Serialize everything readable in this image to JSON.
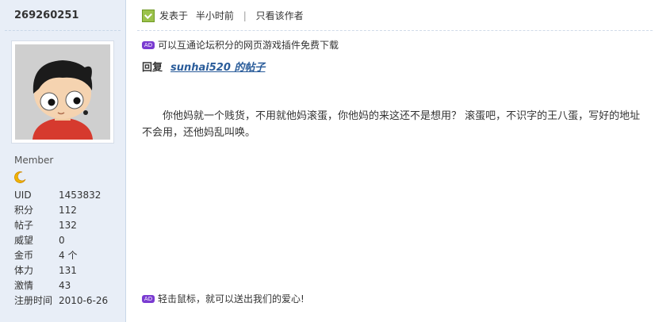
{
  "user": {
    "name": "269260251",
    "rank": "Member",
    "stats": [
      {
        "label": "UID",
        "value": "1453832"
      },
      {
        "label": "积分",
        "value": "112"
      },
      {
        "label": "帖子",
        "value": "132"
      },
      {
        "label": "威望",
        "value": "0"
      },
      {
        "label": "金币",
        "value": "4 个"
      },
      {
        "label": "体力",
        "value": "131"
      },
      {
        "label": "激情",
        "value": "43"
      },
      {
        "label": "注册时间",
        "value": "2010-6-26"
      }
    ]
  },
  "post": {
    "posted_label": "发表于",
    "posted_time": "半小时前",
    "author_only": "只看该作者",
    "ad_top": "可以互通论坛积分的网页游戏插件免费下载",
    "reply_prefix": "回复",
    "reply_link": "sunhai520 的帖子",
    "body": "你他妈就一个贱货，不用就他妈滚蛋，你他妈的来这还不是想用？ 滚蛋吧，不识字的王八蛋，写好的地址不会用，还他妈乱叫唤。",
    "ad_bottom": "轻击鼠标，就可以送出我们的爱心!",
    "ad_badge": "AD"
  },
  "colors": {
    "sidebar_bg": "#e8eef7",
    "link": "#2a5c9a",
    "ad_badge": "#7a3bd1"
  }
}
